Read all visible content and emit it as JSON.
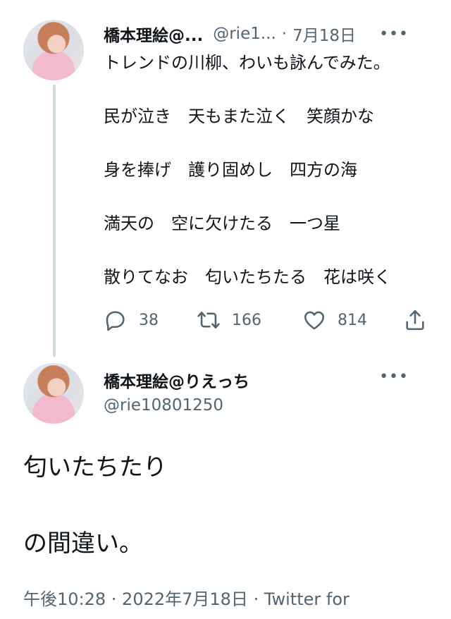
{
  "tweet1": {
    "display_name": "橋本理絵@...",
    "handle": "@rie1...",
    "separator": "·",
    "date": "7月18日",
    "more_icon": "•••",
    "lines": [
      "トレンドの川柳、わいも詠んでみた。",
      "",
      "民が泣き　天もまた泣く　笑顔かな",
      "",
      "身を捧げ　護り固めし　四方の海",
      "",
      "満天の　空に欠けたる　一つ星",
      "",
      "散りてなお　匂いたちたる　花は咲く"
    ],
    "reply_count": "38",
    "retweet_count": "166",
    "like_count": "814"
  },
  "tweet2": {
    "display_name": "橋本理絵@りえっち",
    "handle": "@rie10801250",
    "more_icon": "•••",
    "lines": [
      "匂いたちたり",
      "",
      "の間違い。"
    ],
    "meta": "午後10:28 · 2022年7月18日 · Twitter for"
  },
  "icons": {
    "reply": "speech-bubble-icon",
    "retweet": "retweet-arrows-icon",
    "like": "heart-icon",
    "share": "share-upload-icon"
  },
  "colors": {
    "text": "#0f1419",
    "secondary": "#536471",
    "thread_line": "#cfd9de"
  }
}
